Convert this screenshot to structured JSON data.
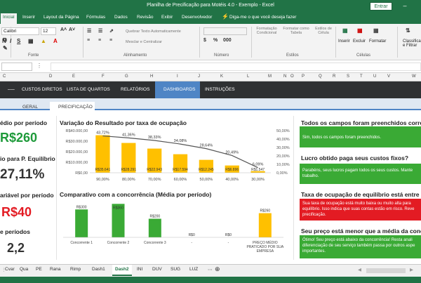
{
  "titlebar": {
    "title": "Planilha de Precificação para Motéis 4.0 - Exemplo  -  Excel",
    "enter_label": "Entrar",
    "minimize": "–"
  },
  "ribbon": {
    "tabs": [
      "Inicial",
      "Inserir",
      "Layout da Página",
      "Fórmulas",
      "Dados",
      "Revisão",
      "Exibir",
      "Desenvolvedor"
    ],
    "tell_me": "Diga-me o que você deseja fazer",
    "font_name": "Calibri",
    "font_size": "12",
    "wrap_text": "Quebrar Texto Automaticamente",
    "merge_center": "Mesclar e Centralizar",
    "format_cond": "Formatação Condicional",
    "format_table": "Formatar como Tabela",
    "cell_styles": "Estilos de Célula",
    "insert": "Inserir",
    "delete": "Excluir",
    "format": "Formatar",
    "sort_filter": "Classificar e Filtrar",
    "groups": {
      "font": "Fonte",
      "alignment": "Alinhamento",
      "number": "Número",
      "styles": "Estilos",
      "cells": "Células"
    }
  },
  "columns": [
    "C",
    "D",
    "E",
    "F",
    "G",
    "H",
    "I",
    "J",
    "K",
    "L",
    "M",
    "N",
    "O",
    "P",
    "Q",
    "R",
    "S",
    "T",
    "U",
    "V",
    "W"
  ],
  "nav": {
    "items": [
      "CUSTOS DIRETOS",
      "LISTA DE QUARTOS",
      "RELATÓRIOS",
      "DASHBOARDS",
      "INSTRUÇÕES"
    ]
  },
  "subnav": {
    "items": [
      "GERAL",
      "PRECIFICAÇÃO"
    ]
  },
  "kpis": [
    {
      "label": "édio por período",
      "value": "R$260",
      "color": "#1e9a3a"
    },
    {
      "label": "io para P. Equilíbrio",
      "value": "27,11%",
      "color": "#333333"
    },
    {
      "label": "ariável por período",
      "value": "R$40",
      "color": "#e31b23"
    },
    {
      "label": "e períodos",
      "value": "2,2",
      "color": "#333333"
    }
  ],
  "charts": {
    "occupancy_title": "Variação do Resultado por taxa de ocupação",
    "competition_title": "Comparativo com a concorrência (Média por período)"
  },
  "chart_data": [
    {
      "type": "bar",
      "title": "Variação do Resultado por taxa de ocupação",
      "categories": [
        "90,00%",
        "80,00%",
        "70,00%",
        "60,00%",
        "50,00%",
        "40,00%",
        "30,00%"
      ],
      "series": [
        {
          "values": [
            35641,
            28291,
            22943,
            17594,
            12245,
            6896,
            1547
          ],
          "labels": [
            "R$35.641",
            "R$28.291",
            "R$22.943",
            "R$17.594",
            "R$12.245",
            "R$6.896",
            "R$1.547"
          ]
        },
        {
          "values": [
            43.72,
            41.36,
            38.33,
            34.08,
            28.64,
            20.49,
            6.09
          ],
          "labels": [
            "43,72%",
            "41,36%",
            "38,33%",
            "34,08%",
            "28,64%",
            "20,49%",
            "6,09%"
          ]
        }
      ],
      "ylim": [
        0,
        40000
      ],
      "y_ticks": [
        "R$0,00",
        "R$10.000,00",
        "R$20.000,00",
        "R$30.000,00",
        "R$40.000,00"
      ],
      "y2_ticks": [
        "0,00%",
        "10,00%",
        "20,00%",
        "30,00%",
        "40,00%",
        "50,00%"
      ],
      "y2lim": [
        0,
        50
      ]
    },
    {
      "type": "bar",
      "title": "Comparativo com a concorrência (Média por período)",
      "categories": [
        "Concorrente 1",
        "Concorrente 2",
        "Concorrente 3",
        "-",
        "-",
        "PREÇO MÉDIO PRATICADO POR SUA EMPRESA"
      ],
      "values": [
        300,
        360,
        200,
        0,
        0,
        260
      ],
      "labels": [
        "R$300",
        "R$360",
        "R$200",
        "R$0",
        "R$0",
        "R$260"
      ],
      "ylim": [
        0,
        400
      ]
    }
  ],
  "checks": [
    {
      "title": "Todos os campos foram preenchidos corretam",
      "text": "Sim, todos os campos foram preenchidos.",
      "color": "#3aaa35"
    },
    {
      "title": "Lucro obtido paga seus custos fixos?",
      "text": "Parabéns, seus lucros pagam todos os seus custos. Mante trabalho.",
      "color": "#3aaa35"
    },
    {
      "title": "Taxa de ocupação de equilíbrio está entre 40 e",
      "text": "Sua taxa de ocupação está muito baixa ou muito alta para equilíbrio. Isso indica que suas contas estão em risco. Reve precificação.",
      "color": "#e31b23"
    },
    {
      "title": "Seu preço está menor que a média da concorrênc",
      "text": "Ótimo! Seu preço está abaixo da concorrência! Resta anali diferenciação de seu serviço também passa por outros aspe importantes.",
      "color": "#3aaa35"
    }
  ],
  "sheet_tabs": [
    "Cvar",
    "Qua",
    "PE",
    "Rana",
    "Rimp",
    "Dash1",
    "Dash2",
    "INI",
    "DUV",
    "SUG",
    "LUZ"
  ],
  "active_sheet": "Dash2",
  "colors": {
    "excel_green": "#217346",
    "bar_gold": "#ffc000",
    "bar_green": "#3aaa35",
    "nav_dark": "#2f3133",
    "accent_blue": "#4f85c5"
  }
}
